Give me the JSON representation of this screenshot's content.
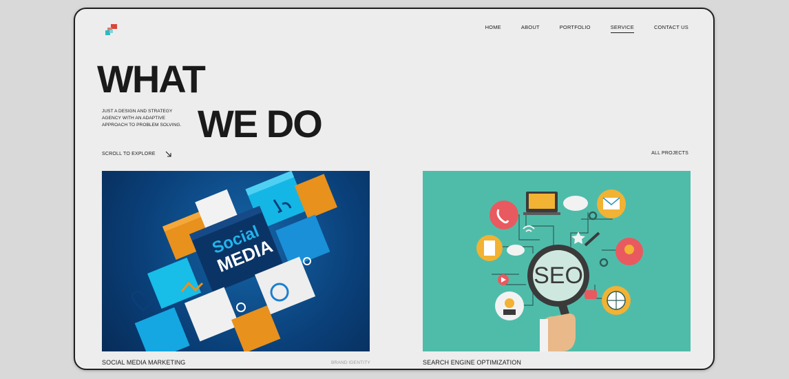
{
  "nav": {
    "items": [
      {
        "label": "HOME",
        "active": false
      },
      {
        "label": "ABOUT",
        "active": false
      },
      {
        "label": "PORTFOLIO",
        "active": false
      },
      {
        "label": "SERVICE",
        "active": true
      },
      {
        "label": "CONTACT US",
        "active": false
      }
    ]
  },
  "hero": {
    "line1": "WHAT",
    "line2": "WE DO",
    "tagline": "JUST A DESIGN AND STRATEGY AGENCY WITH AN ADAPTIVE APPROACH TO PROBLEM SOLVING."
  },
  "actions": {
    "scroll_label": "SCROLL TO EXPLORE",
    "all_projects_label": "ALL PROJECTS"
  },
  "cards": [
    {
      "title": "SOCIAL MEDIA MARKETING",
      "tag": "BRAND IDENTITY",
      "image_text_1": "Social",
      "image_text_2": "MEDIA"
    },
    {
      "title": "SEARCH ENGINE OPTIMIZATION",
      "image_text": "SEO"
    }
  ],
  "colors": {
    "logo_red": "#d9463a",
    "logo_teal": "#2fb7c4",
    "social_blue": "#0a3f78",
    "seo_teal": "#4fbcaa"
  }
}
